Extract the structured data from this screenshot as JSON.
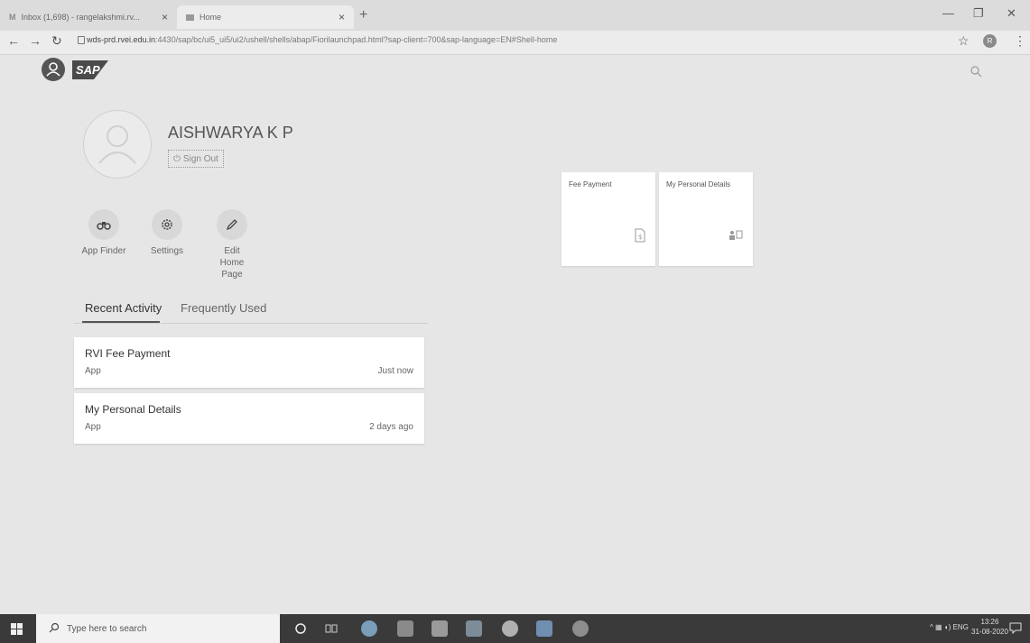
{
  "browser": {
    "tabs": [
      {
        "title": "Inbox (1,698) - rangelakshmi.rv..."
      },
      {
        "title": "Home"
      }
    ],
    "new_tab": "+",
    "url_host": "wds-prd.rvei.edu.in",
    "url_rest": ":4430/sap/bc/ui5_ui5/ui2/ushell/shells/abap/Fiorilaunchpad.html?sap-client=700&sap-language=EN#Shell-home",
    "profile_initial": "R"
  },
  "shell": {
    "logo_text": "SAP"
  },
  "user": {
    "name": "AISHWARYA K P",
    "sign_out_label": "Sign Out"
  },
  "quick_actions": [
    {
      "label": "App Finder",
      "icon": "binoculars-icon"
    },
    {
      "label": "Settings",
      "icon": "gear-icon"
    },
    {
      "label": "Edit Home Page",
      "icon": "pencil-icon"
    }
  ],
  "activity_tabs": {
    "recent": "Recent Activity",
    "frequent": "Frequently Used"
  },
  "recent_activity": [
    {
      "title": "RVI Fee Payment",
      "type": "App",
      "when": "Just now"
    },
    {
      "title": "My Personal Details",
      "type": "App",
      "when": "2 days ago"
    }
  ],
  "tiles": [
    {
      "title": "Fee Payment",
      "icon": "receipt-icon"
    },
    {
      "title": "My Personal Details",
      "icon": "personal-details-icon"
    }
  ],
  "taskbar": {
    "search_placeholder": "Type here to search",
    "tray_lang": "ENG",
    "time": "13:26",
    "date": "31-08-2020"
  },
  "colors": {
    "background": "#e6e6e6",
    "tile": "#ffffff",
    "taskbar": "#3a3a3a"
  }
}
